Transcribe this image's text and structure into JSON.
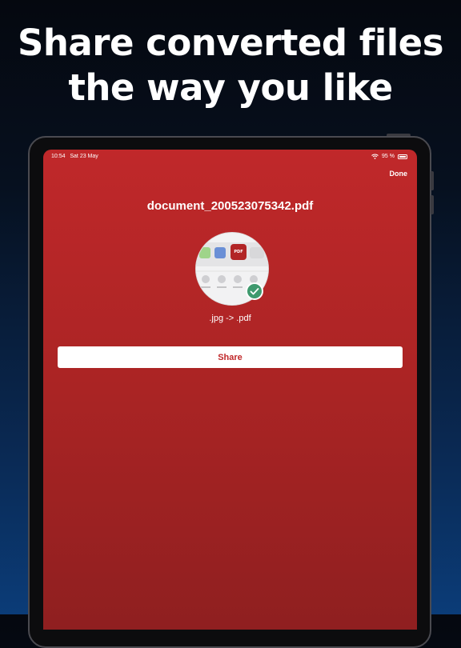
{
  "headline": {
    "line1": "Share converted files",
    "line2": "the way you like"
  },
  "status_bar": {
    "time": "10:54",
    "date": "Sat 23 May",
    "battery": "95 %"
  },
  "nav": {
    "done_label": "Done"
  },
  "file": {
    "name": "document_200523075342.pdf",
    "conversion": ".jpg -> .pdf"
  },
  "actions": {
    "share_label": "Share"
  },
  "icons": {
    "wifi": "wifi-icon",
    "battery": "battery-icon",
    "success": "checkmark-icon"
  },
  "colors": {
    "accent_red": "#c0282a",
    "success_green": "#3f9a6e"
  }
}
